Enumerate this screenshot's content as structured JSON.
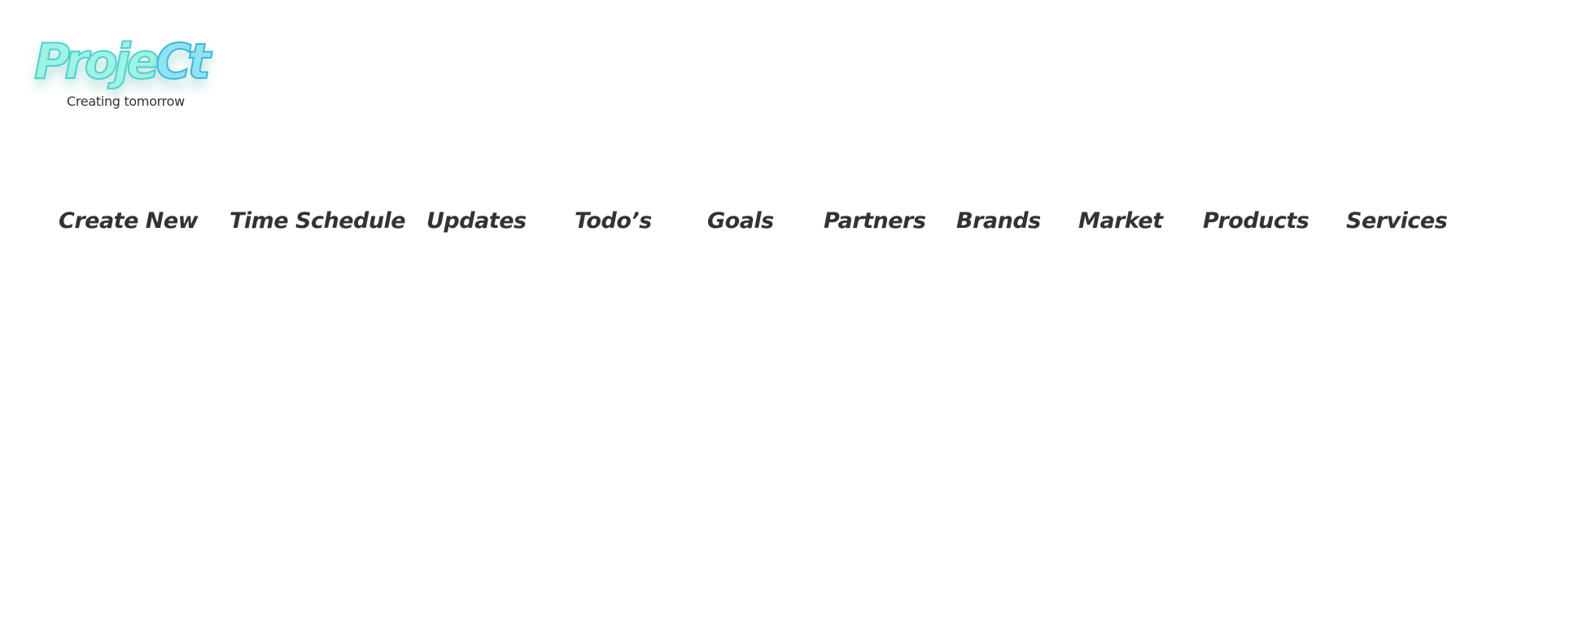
{
  "logo": {
    "word_part1": "Proje",
    "word_part2": "Ct",
    "tagline": "Creating tomorrow",
    "colors": {
      "fill": "#9ef3e4",
      "stroke": "#4fd0cf",
      "accent_fill": "#8fe3f2",
      "accent_stroke": "#3fb8d8"
    }
  },
  "nav": {
    "items": [
      {
        "label": "Create New"
      },
      {
        "label": "Time Schedule"
      },
      {
        "label": "Updates"
      },
      {
        "label": "Todo’s"
      },
      {
        "label": "Goals"
      },
      {
        "label": "Partners"
      },
      {
        "label": "Brands"
      },
      {
        "label": "Market"
      },
      {
        "label": "Products"
      },
      {
        "label": "Services"
      }
    ],
    "text_color": "#333333"
  }
}
